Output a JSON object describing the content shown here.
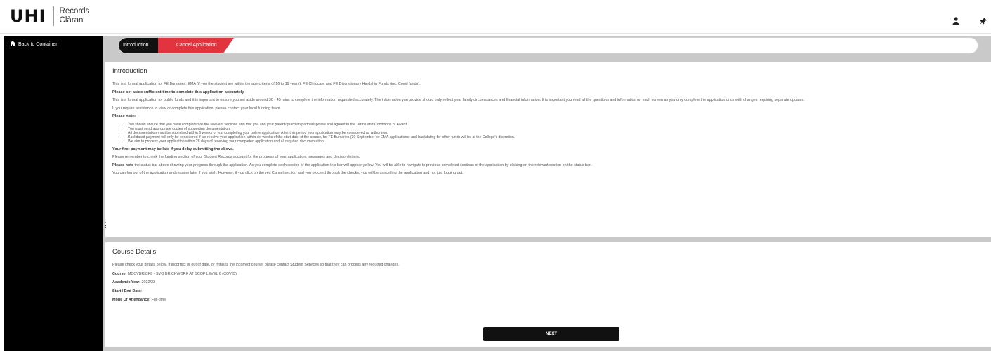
{
  "header": {
    "logo_mark": "UHI",
    "logo_line1": "Records",
    "logo_line2": "Clàran",
    "icons": [
      "user-icon",
      "pin-icon"
    ]
  },
  "sidebar": {
    "back_label": "Back to Container",
    "back_icon": "home-icon"
  },
  "progress": {
    "steps": [
      {
        "label": "Introduction",
        "color": "#111111"
      },
      {
        "label": "Cancel Application",
        "color": "#e2343f"
      }
    ]
  },
  "intro": {
    "title": "Introduction",
    "p1": "This is a formal application for FE Bursaries, EMA (if you the student are within the age criteria of 16 to 19 years), FE Childcare and FE Discretionary Hardship Funds (inc. Covid funds).",
    "p2_bold": "Please set aside sufficient time to complete this application accurately",
    "p3": "This is a formal application for public funds and it is important to ensure you set aside around 30 - 45 mins to complete the information requested accurately. The information you provide should truly reflect your family circumstances and financial information. It is important you read all the questions and information on each screen as you only complete the application once with changes requiring separate updates.",
    "p4": "If you require assistance to view or complete this application, please contact your local funding team.",
    "note_title": "Please note:",
    "notes": [
      "You should ensure that you have completed all the relevant sections and that you and your parent/guardian/partner/spouse and agreed to the Terms and Conditions of Award.",
      "You must send appropriate copies of supporting documentation.",
      "All documentation must be submitted within 6 weeks of you completing your online application. After this period your application may be considered as withdrawn.",
      "Backdated payment will only be considered if we receive your application within six weeks of the start date of the course, for FE Bursaries (30 September for EMA applications) and backdating for other funds will be at the College's discretion.",
      "We aim to process your application within 28 days of receiving your completed application and all required documentation."
    ],
    "p5_bold": "Your first payment may be late if you delay submitting the above.",
    "p6": "Please remember to check the funding section of your Student Records account for the progress of your application, messages and decision letters.",
    "p7_lead": "Please note",
    "p7": " the status bar above showing your progress through the application. As you complete each section of the application this bar will appear yellow. You will be able to navigate to previous completed sections of the application by clicking on the relevant section on the status bar.",
    "p8": "You can log out of the application and resume later if you wish. However, if you click on the red Cancel section and you proceed through the checks, you will be cancelling the application and not just logging out."
  },
  "course": {
    "title": "Course Details",
    "intro": "Please check your details below. If incorrect or out of date, or if this is the incorrect course, please contact Student Services so that they can process any required changes.",
    "course_label": "Course:",
    "course_value": " MDCVBRICK8 - SVQ BRICKWORK AT SCQF LEVEL 6 (COVID)",
    "year_label": "Academic Year:",
    "year_value": " 2022/23",
    "dates_label": "Start / End Date:",
    "dates_value": " -",
    "mode_label": "Mode Of Attendance:",
    "mode_value": " Full-time",
    "next_label": "NEXT"
  }
}
